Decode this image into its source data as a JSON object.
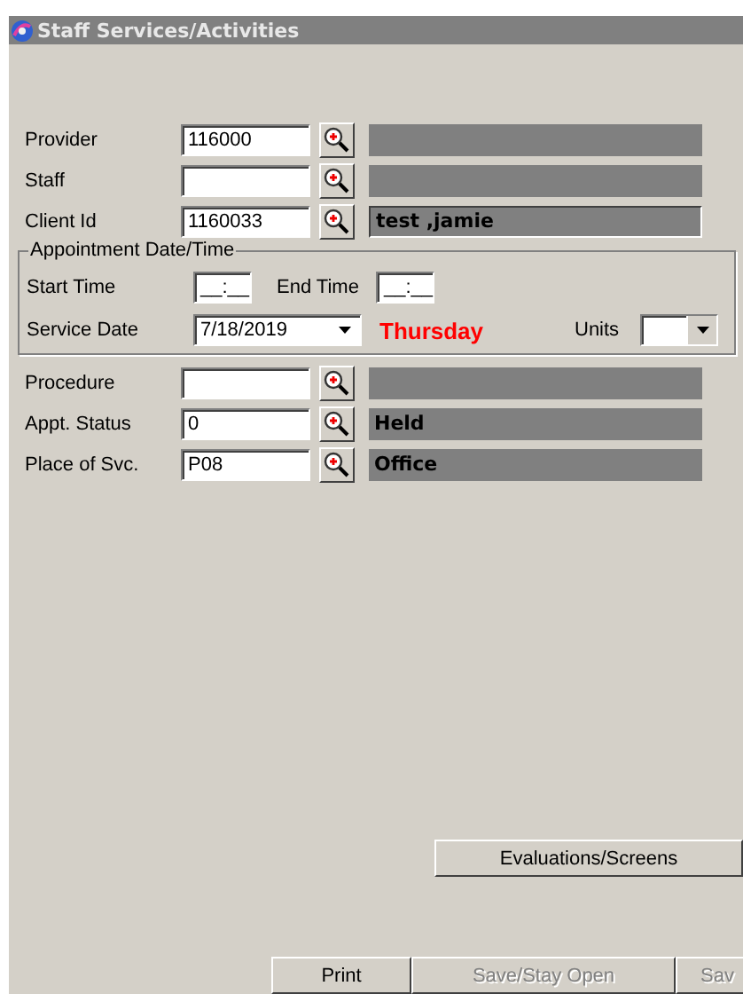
{
  "window": {
    "title": "Staff Services/Activities"
  },
  "lookup_rows": [
    {
      "label": "Provider",
      "value": "116000"
    },
    {
      "label": "Staff"
    },
    {
      "label": "Client Id",
      "value": "1160033",
      "description": "test ,jamie"
    }
  ],
  "appointment": {
    "title": "Appointment Date/Time",
    "start_time_label": "Start Time",
    "start_time": "__:__",
    "end_time_label": "End Time",
    "end_time": "__:__",
    "service_date_label": "Service Date",
    "service_date": "7/18/2019",
    "weekday": "Thursday",
    "units_label": "Units"
  },
  "lookup_rows_2": [
    {
      "label": "Procedure"
    },
    {
      "label": "Appt. Status",
      "value": "0",
      "description": "Held"
    },
    {
      "label": "Place of Svc.",
      "value": "P08",
      "description": "Office"
    }
  ],
  "evaluations_button": "Evaluations/Screens",
  "buttons": [
    {
      "label": "Print",
      "disabled": false
    },
    {
      "label": "Save/Stay Open",
      "disabled": true
    },
    {
      "label": "Sav",
      "disabled": true
    }
  ]
}
